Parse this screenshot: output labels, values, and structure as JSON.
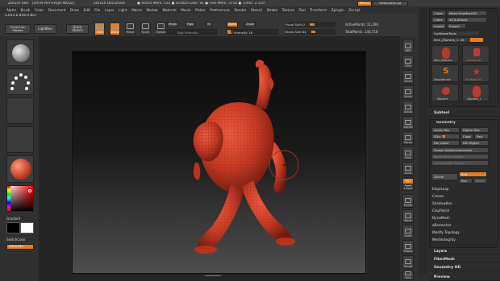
{
  "title_bar": {
    "app": "ZBrush 4R4",
    "build": "[DYFN-PHY-ERQD-NKQZ]",
    "document": "ZBrush Document",
    "stats": "● Active Mem: 532 ● Scratch Disk: 91 ● Free Mem: 3752 ● Timer: 2.119",
    "menus_button": "Menus",
    "script_button": "DefaultZScript"
  },
  "menu": [
    "Alpha",
    "Brush",
    "Color",
    "Document",
    "Draw",
    "Edit",
    "File",
    "Layer",
    "Light",
    "Macro",
    "Marker",
    "Material",
    "Movie",
    "Picker",
    "Preferences",
    "Render",
    "Stencil",
    "Stroke",
    "Texture",
    "Tool",
    "Transform",
    "Zplugin",
    "Zscript"
  ],
  "coords": "1.811,0.416,0.857",
  "toolbar": {
    "projection_master": "Projection Master",
    "lightbox": "LightBox",
    "quick_sketch": "Quick Sketch",
    "edit": "Edit",
    "draw": "Draw",
    "move": "Move",
    "scale": "Scale",
    "rotate": "Rotate",
    "mrgb": "Mrgb",
    "rgb": "Rgb",
    "m": "M",
    "rgb_intensity": "Rgb Intensity",
    "zadd": "Zadd",
    "zsub": "Zsub",
    "z_intensity": "Z Intensity 18",
    "focal_shift": "Focal Shift 0",
    "draw_size": "Draw Size 64",
    "active_points": "ActivePoints: 21,296",
    "total_points": "TotalPoints: 146,718"
  },
  "left_shelf": {
    "gradient": "Gradient",
    "switch_color": "SwitchColor",
    "alternate": "Alternate"
  },
  "right_shelf": [
    "BPR",
    "SPix",
    "Scroll",
    "Zoom",
    "Actual",
    "AAHalf",
    "Persp",
    "Floor",
    "Local",
    "L.Sym",
    "Xyz",
    "Frame",
    "Move",
    "Scale",
    "Rotate",
    "Transp",
    "Solo"
  ],
  "tool_panel": {
    "row1": [
      "Clone",
      "Make PolyMesh3D"
    ],
    "row2": [
      "Clone",
      "All SubTools"
    ],
    "row3": [
      "Import",
      "Export"
    ],
    "lightbox_tools": "Lightbox▸Tools",
    "current_tool": "Skin_ZSphere_1. 48",
    "tools": [
      {
        "label": "Skin_ZSphere",
        "color": "#b23a2a"
      },
      {
        "label": "Cylinder3D",
        "color": "#c23a2e"
      },
      {
        "label": "SimpleBrush",
        "color": "#e07a1c"
      },
      {
        "label": "PolyMesh3D",
        "color": "#c8322a"
      },
      {
        "label": "ZSphere",
        "color": "#b83a2a"
      },
      {
        "label": "ZSphere_1",
        "color": "#c03a2c"
      }
    ],
    "subtool": "Subtool",
    "geometry": "Geometry",
    "lower_res": "Lower Res",
    "higher_res": "Higher Res",
    "sdiv": "SDiv 1",
    "cage": "Cage",
    "rstr": "Rstr",
    "del_lower": "Del Lower",
    "del_higher": "Del Higher",
    "freeze": "Freeze SubdivisionLevels",
    "reconstruct": "Reconstruct Subdiv",
    "convert_bpr": "Convert BPR To Geo",
    "divide": "Divide",
    "smt": "Smt",
    "suv": "Suv",
    "reuv": "ReUV",
    "sections": [
      "EdgeLoop",
      "Crease",
      "ShadowBox",
      "ClayPolish",
      "DynaMesh",
      "qRemesher",
      "Modify Topology",
      "MeshIntegrity"
    ],
    "bottom_sections": [
      "Layers",
      "FiberMesh",
      "Geometry HD",
      "Preview"
    ]
  }
}
